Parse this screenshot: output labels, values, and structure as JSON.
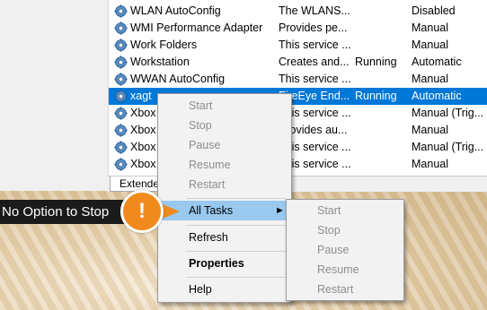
{
  "services": [
    {
      "name": "WLAN AutoConfig",
      "description": "The WLANS...",
      "status": "",
      "startup": "Disabled"
    },
    {
      "name": "WMI Performance Adapter",
      "description": "Provides pe...",
      "status": "",
      "startup": "Manual"
    },
    {
      "name": "Work Folders",
      "description": "This service ...",
      "status": "",
      "startup": "Manual"
    },
    {
      "name": "Workstation",
      "description": "Creates and...",
      "status": "Running",
      "startup": "Automatic"
    },
    {
      "name": "WWAN AutoConfig",
      "description": "This service ...",
      "status": "",
      "startup": "Manual"
    },
    {
      "name": "xagt",
      "description": "FireEye End...",
      "status": "Running",
      "startup": "Automatic"
    },
    {
      "name": "Xbox",
      "description": "This service ...",
      "status": "",
      "startup": "Manual (Trig..."
    },
    {
      "name": "Xbox",
      "description": "Provides au...",
      "status": "",
      "startup": "Manual"
    },
    {
      "name": "Xbox",
      "description": "This service ...",
      "status": "",
      "startup": "Manual (Trig..."
    },
    {
      "name": "Xbox",
      "description": "This service ...",
      "status": "",
      "startup": "Manual"
    }
  ],
  "tabs": {
    "extended": "Extended"
  },
  "context_menu": {
    "start": "Start",
    "stop": "Stop",
    "pause": "Pause",
    "resume": "Resume",
    "restart": "Restart",
    "all_tasks": "All Tasks",
    "refresh": "Refresh",
    "properties": "Properties",
    "help": "Help"
  },
  "submenu": {
    "start": "Start",
    "stop": "Stop",
    "pause": "Pause",
    "resume": "Resume",
    "restart": "Restart"
  },
  "callout": {
    "text": "No Option to Stop",
    "badge": "!"
  },
  "colors": {
    "selection": "#0078d7",
    "highlight": "#99c9ef",
    "badge": "#f08a1c"
  }
}
